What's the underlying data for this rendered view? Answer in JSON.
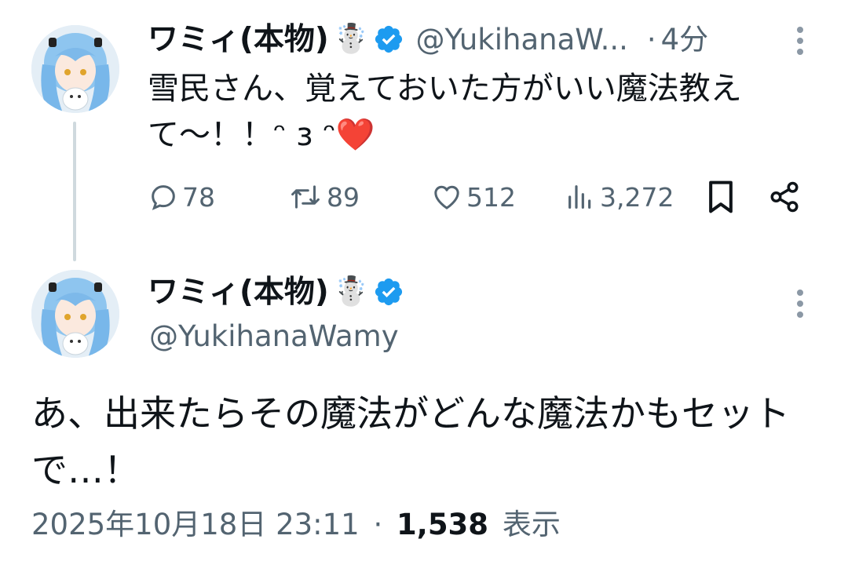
{
  "reply_tweet": {
    "display_name": "ワミィ(本物)",
    "name_emoji": "☃️",
    "handle": "@YukihanaW...",
    "separator": "·",
    "time_ago": "4分",
    "text": "雪民さん、覚えておいた方がいい魔法教えて〜！！ᵔ з ᵔ❤️",
    "actions": {
      "replies": "78",
      "reposts": "89",
      "likes": "512",
      "views": "3,272"
    }
  },
  "main_tweet": {
    "display_name": "ワミィ(本物)",
    "name_emoji": "☃️",
    "handle": "@YukihanaWamy",
    "text": "あ、出来たらその魔法がどんな魔法かもセットで…！",
    "timestamp": "2025年10月18日 23:11",
    "separator": "·",
    "view_count": "1,538",
    "view_label": "表示"
  },
  "colors": {
    "verified_blue": "#1d9bf0",
    "secondary_text": "#536471",
    "primary_text": "#0f1419",
    "thread_line": "#cfd9de"
  },
  "icons": {
    "reply": "reply-icon",
    "repost": "repost-icon",
    "like": "heart-icon",
    "views": "views-icon",
    "bookmark": "bookmark-icon",
    "share": "share-icon",
    "more": "more-vertical-icon",
    "verified": "verified-badge-icon"
  }
}
